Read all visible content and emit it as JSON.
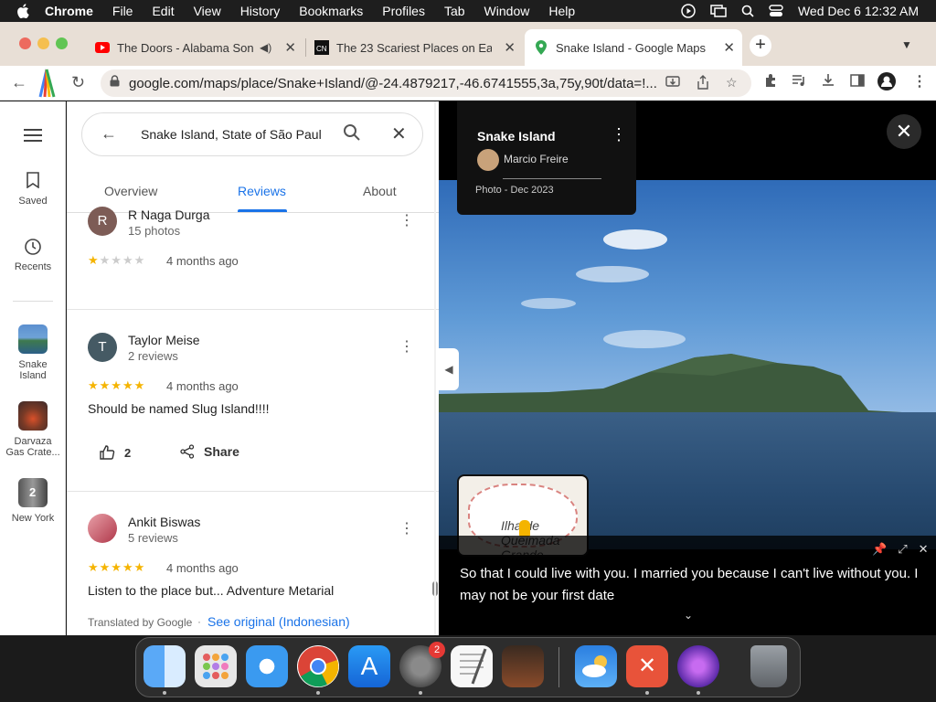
{
  "menubar": {
    "app": "Chrome",
    "items": [
      "File",
      "Edit",
      "View",
      "History",
      "Bookmarks",
      "Profiles",
      "Tab",
      "Window",
      "Help"
    ],
    "clock": "Wed Dec 6  12:32 AM"
  },
  "tabs": [
    {
      "title": "The Doors - Alabama Son",
      "favicon": "youtube-icon"
    },
    {
      "title": "The 23 Scariest Places on Ear",
      "favicon": "cnt-icon"
    },
    {
      "title": "Snake Island - Google Maps",
      "favicon": "maps-pin-icon"
    }
  ],
  "address": {
    "url": "google.com/maps/place/Snake+Island/@-24.4879217,-46.6741555,3a,75y,90t/data=!..."
  },
  "rail": {
    "saved": "Saved",
    "recents": "Recents",
    "places": [
      {
        "label": "Snake\nIsland"
      },
      {
        "label": "Darvaza\nGas Crate..."
      },
      {
        "label": "New York",
        "count": "2"
      }
    ]
  },
  "search": {
    "query": "Snake Island, State of São Paul"
  },
  "panel_tabs": {
    "overview": "Overview",
    "reviews": "Reviews",
    "about": "About"
  },
  "reviews": [
    {
      "initial": "R",
      "name": "R Naga Durga",
      "sub": "15 photos",
      "rating": 1,
      "time": "4 months ago"
    },
    {
      "initial": "T",
      "name": "Taylor Meise",
      "sub": "2 reviews",
      "rating": 5,
      "time": "4 months ago",
      "text": "Should be named Slug Island!!!!",
      "likes": "2",
      "share": "Share"
    },
    {
      "initial": "A",
      "name": "Ankit Biswas",
      "sub": "5 reviews",
      "rating": 5,
      "time": "4 months ago",
      "text": "Listen to the place but... Adventure Metarial",
      "translated": "Translated by Google",
      "see_original": "See original (Indonesian)"
    }
  ],
  "photo": {
    "place": "Snake Island",
    "author": "Marcio Freire",
    "date": "Photo - Dec 2023",
    "minimap_label": "Ilha de\nQueimada\nGrande"
  },
  "caption": {
    "text": "So that I could live with you. I married you because I can't live without you. I may not be your first date"
  },
  "dock": {
    "settings_badge": "2"
  }
}
